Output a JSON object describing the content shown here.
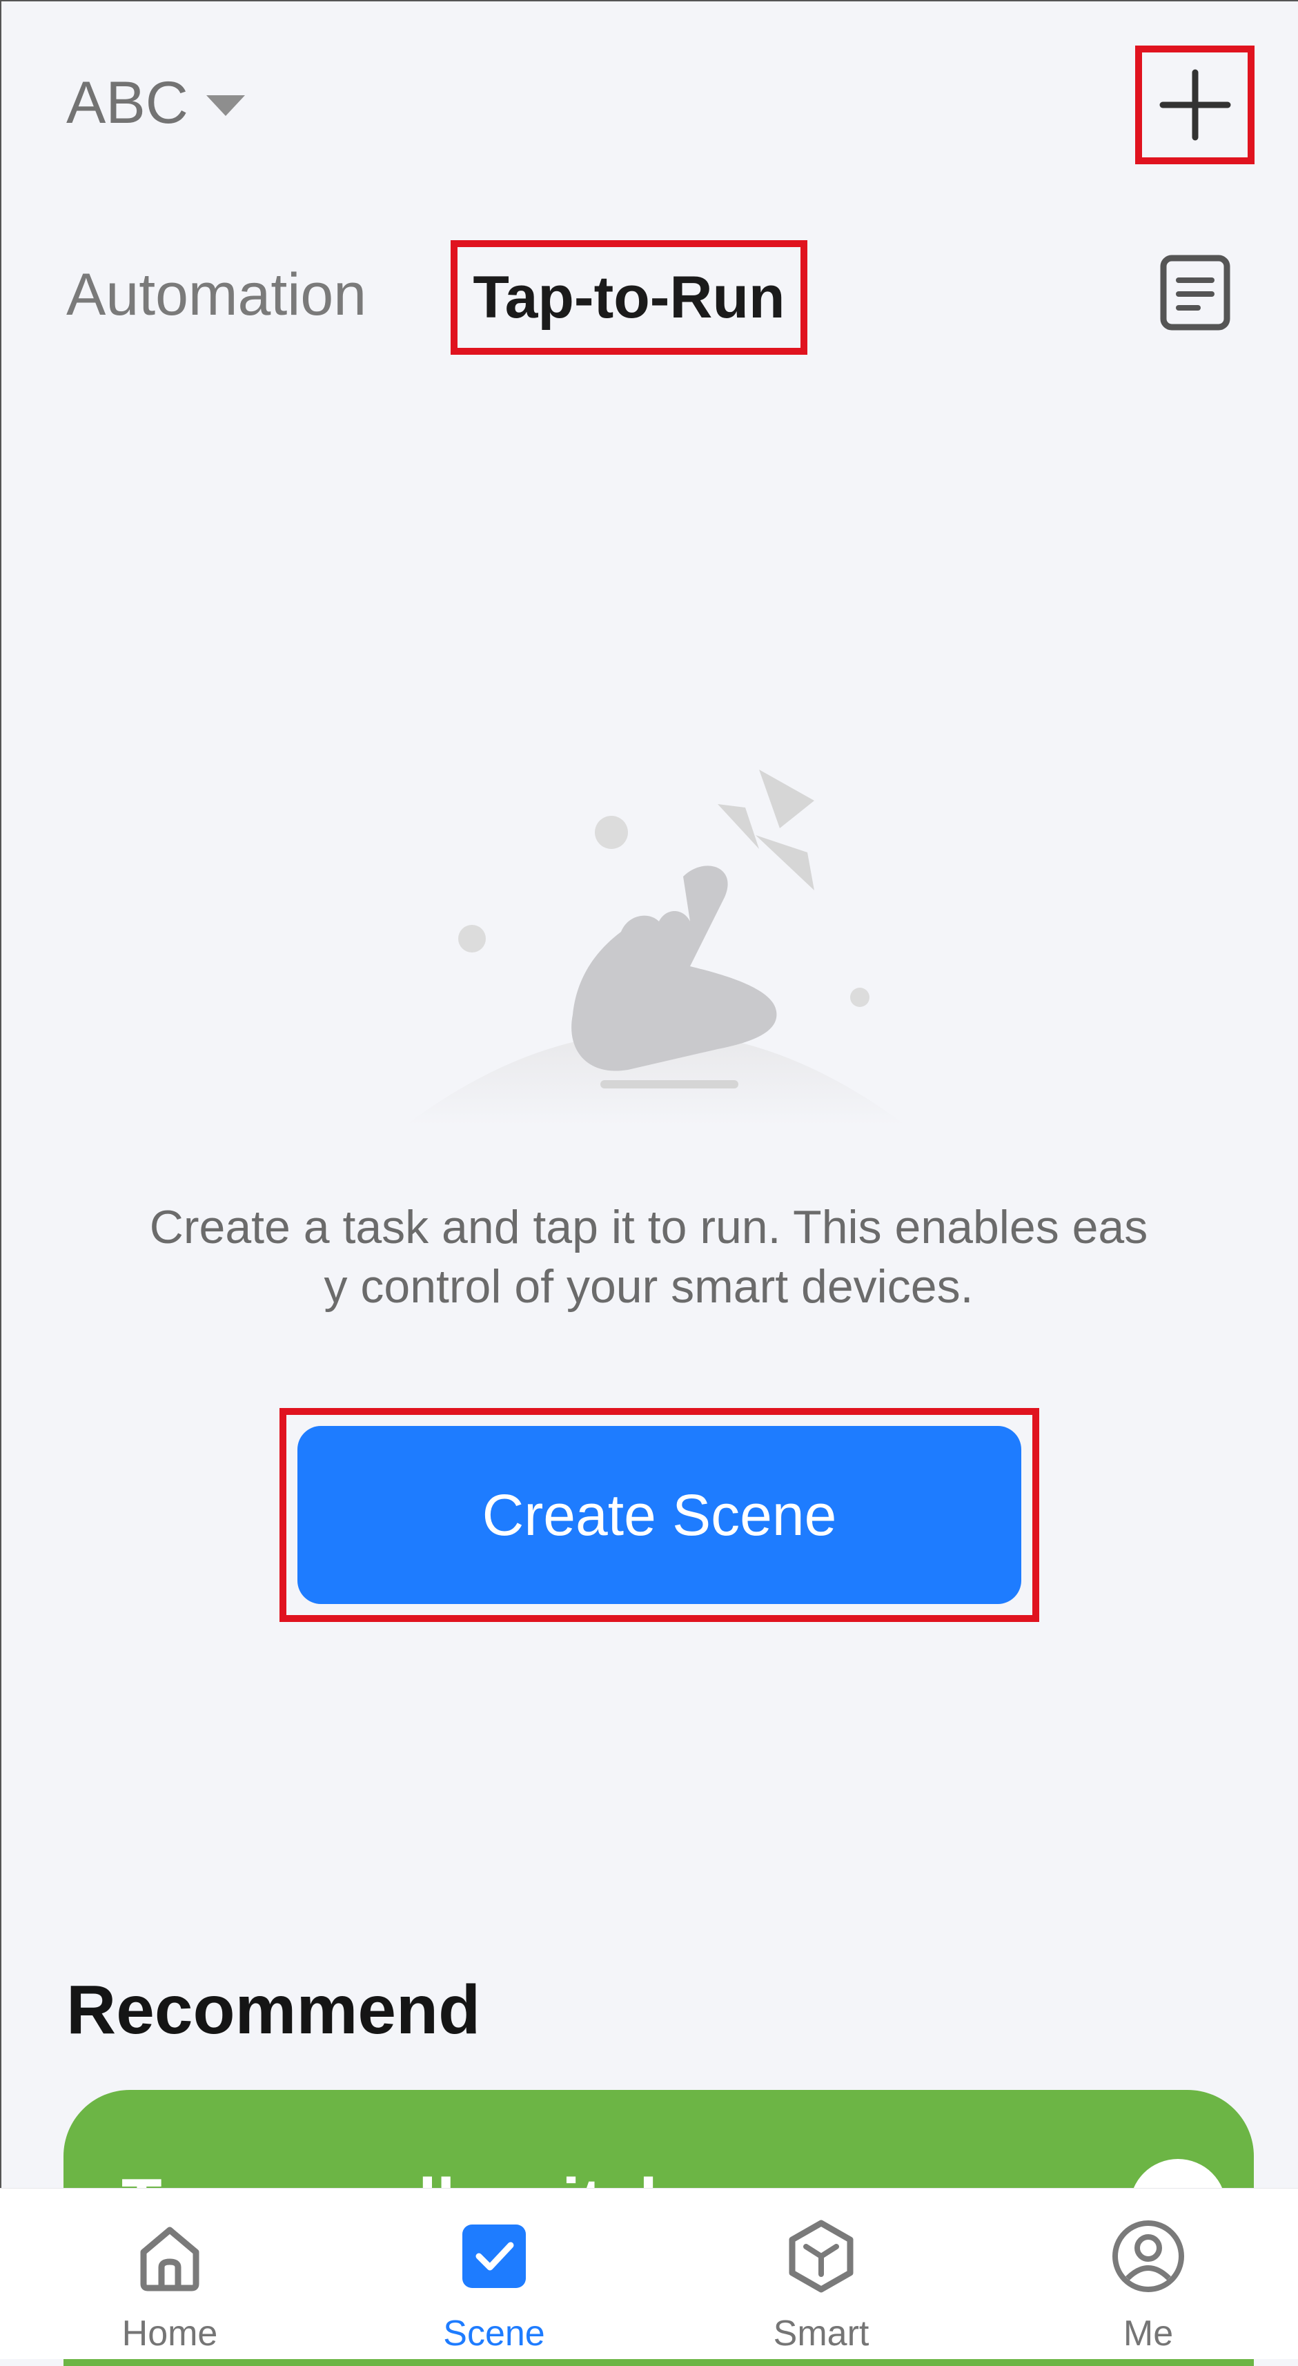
{
  "header": {
    "home_name": "ABC"
  },
  "tabs": {
    "automation": "Automation",
    "tap_to_run": "Tap-to-Run"
  },
  "empty_state": {
    "line1": "Create a task and tap it to run. This enables eas",
    "line2": "y control of your smart devices.",
    "button_label": "Create Scene"
  },
  "recommend": {
    "title": "Recommend",
    "card_title": "Turn on all switches"
  },
  "bottom_nav": {
    "items": [
      {
        "label": "Home",
        "icon": "home-icon"
      },
      {
        "label": "Scene",
        "icon": "scene-check-icon"
      },
      {
        "label": "Smart",
        "icon": "smart-cube-icon"
      },
      {
        "label": "Me",
        "icon": "profile-icon"
      }
    ],
    "active_color": "#1e7cff",
    "inactive_color": "#757575"
  },
  "colors": {
    "highlight": "#e0131f",
    "primary_button": "#1e7cff",
    "recommend_card": "#6cb545"
  }
}
